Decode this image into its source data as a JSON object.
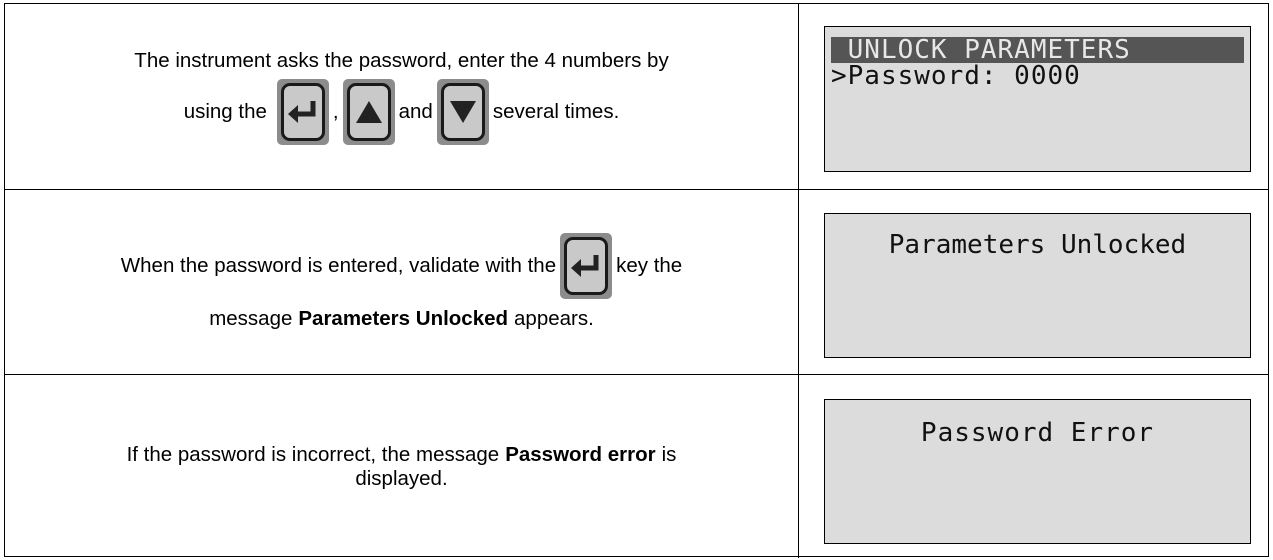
{
  "rows": [
    {
      "instruction": {
        "line1": "The instrument asks the password, enter the 4 numbers by",
        "using_the": "using the",
        "comma": ",",
        "and": "and",
        "several_times": "several times."
      },
      "keys": [
        "enter-key",
        "up-arrow-key",
        "down-arrow-key"
      ],
      "lcd": {
        "line1": " UNLOCK PARAMETERS",
        "line2": ">Password: 0000"
      }
    },
    {
      "instruction": {
        "line1_pre": "When the password is entered, validate with the",
        "line1_post": "key the",
        "line2_pre": "message",
        "line2_bold": "Parameters Unlocked",
        "line2_post": "appears."
      },
      "keys": [
        "enter-key"
      ],
      "lcd": {
        "line1": "Parameters Unlocked"
      }
    },
    {
      "instruction": {
        "line1_pre": "If the password is incorrect, the message",
        "line1_bold": "Password error",
        "line1_post": "is",
        "line2": "displayed."
      },
      "lcd": {
        "line1": "Password Error"
      }
    }
  ],
  "colors": {
    "lcd_bg": "#dcdcdc",
    "lcd_header_bg": "#555555",
    "key_bg": "#c9c9c9"
  }
}
